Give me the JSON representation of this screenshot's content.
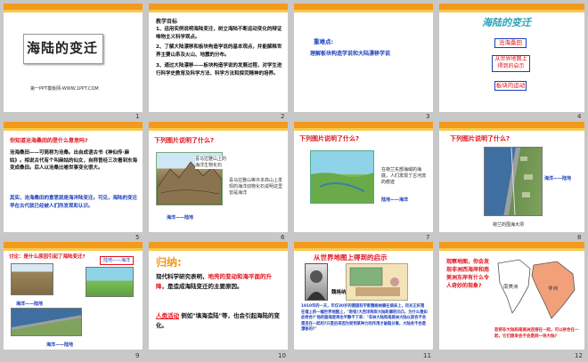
{
  "slides": [
    {
      "num": "1",
      "title": "海陆的变迁",
      "footer": "第一PPT模板网-WWW.1PPT.COM"
    },
    {
      "num": "2",
      "heading": "教学目标",
      "lines": [
        "1、运用实例说明海陆变迁，树立海陆不断运动变化的辩证唯物主义科学观点。",
        "2、了解大陆漂移和板块构造学说的基本观点，并能解释世界主要山系及火山、地震的分布。",
        "3、通过大陆漂移——板块构造学说的发展过程，对学生进行科学史教育及科学方法、科学方法和探究精神的培养。"
      ]
    },
    {
      "num": "3",
      "label": "重难点:",
      "text": "理解板块构造学说和大陆漂移学说"
    },
    {
      "num": "4",
      "title": "海陆的变迁",
      "items": [
        "沧海桑田",
        "从世界地图上得到的启示",
        "板块的运动"
      ]
    },
    {
      "num": "5",
      "question": "你知道沧海桑田的是什么意思吗?",
      "body": "沧海桑田——可简称为沧桑。出自成语古书《神仙传·麻姑》。相说古代有个叫麻姑的仙女，自称曾经三次看到东海变成桑田。后人以沧桑比喻世事变化很大。",
      "conclusion": "其实，沧海桑田的意思就是海洋陆变迁。可见，海陆的变迁早在古代就已经被人们所发现和认识。"
    },
    {
      "num": "6",
      "question": "下列图片说明了什么?",
      "caption": "喜马拉雅山上的海洋生物化石",
      "note": "喜马拉雅山等许多高山上发现的海洋动物化石说明这里曾是海洋",
      "label": "海洋——陆地"
    },
    {
      "num": "7",
      "question": "下列图片说明了什么?",
      "caption": "在荷兰东部海域的海底，人们发现了古河流的痕迹",
      "label": "陆地——海洋"
    },
    {
      "num": "8",
      "question": "下列图片说明了什么?",
      "label": "海洋——陆地",
      "bottom": "荷兰的围海大坝"
    },
    {
      "num": "9",
      "question": "讨论：是什么原因引起了海陆变迁?",
      "label_a": "海洋——陆地",
      "label_b": "陆地——海洋",
      "label_c": "海洋——陆地"
    },
    {
      "num": "10",
      "heading": "归纳:",
      "body_a": "现代科学研究表明，",
      "body_a_red": "地壳的变动和海平面的升降",
      "body_b": "，是造成海陆变迁的主要原因。",
      "body_c": "人类活动",
      "body_d": "例如\"填海造陆\"等，也会引起海陆的变化。"
    },
    {
      "num": "11",
      "title": "从世界地图上得到的启示",
      "person": "魏格纳",
      "body": "1910年的一天，年仅30岁的德国科学家魏格纳躺在病床上，目光正好落在墙上的一幅世界地图上，\"奇怪!大西洋两岸大陆轮廓的凹凸，为什么竟如此吻合?\"他的脑海里再也平静不下来：\"非洲大陆和南美洲大陆以前会不会是连在一起的?只是后来因为受到某种力的作用才破裂分离，大陆会不会是漂移的?\""
    },
    {
      "num": "12",
      "question": "观察地图，你会发现非洲西海岸和南美洲东岸有什么令人奇妙的现象?",
      "map_a": "南美洲",
      "map_b": "非洲",
      "bottom": "若把非大陆和南美洲连接在一起，可以拼合在一起，它们原来会不会是同一块大陆?"
    }
  ],
  "colors": {
    "accent_orange": "#f29a1c",
    "accent_yellow": "#f7c94d",
    "red": "#e2131b",
    "blue": "#1a3fbf",
    "teal": "#2aa2b5"
  }
}
